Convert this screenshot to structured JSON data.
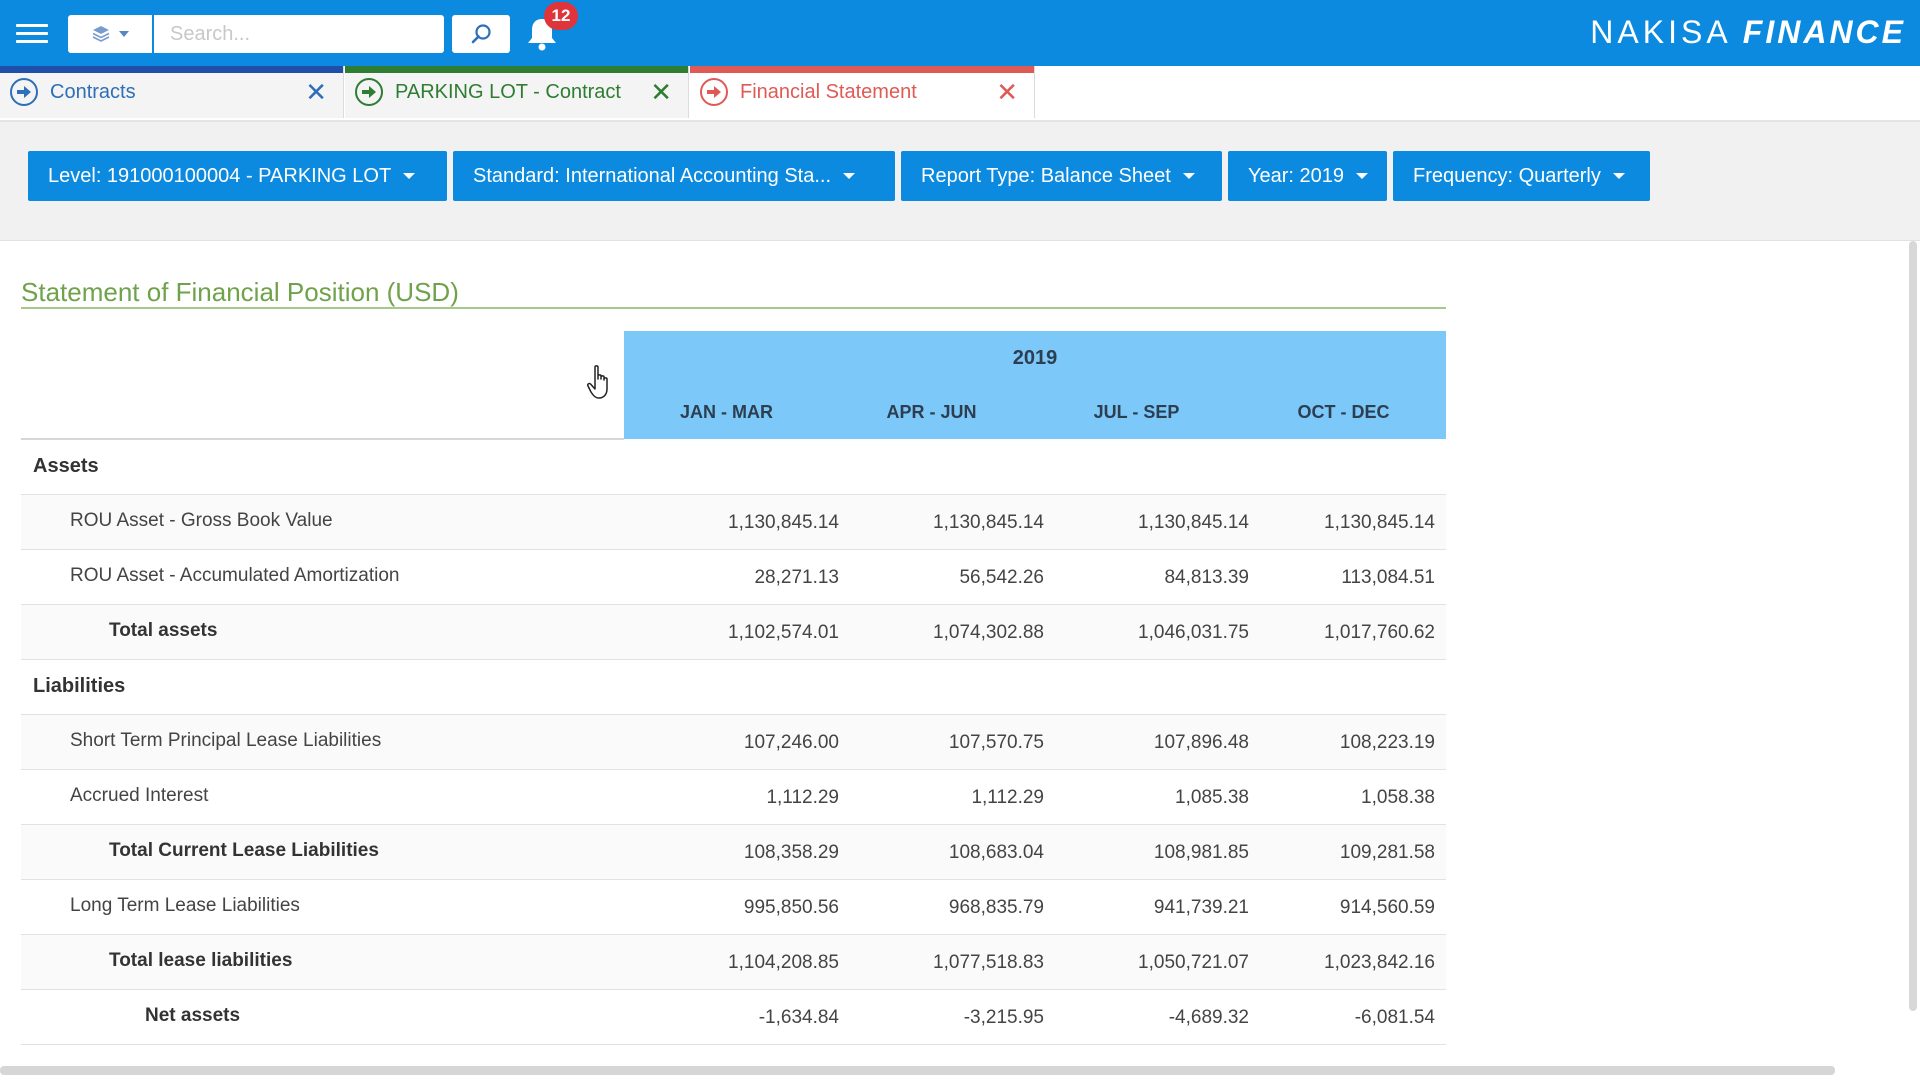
{
  "topbar": {
    "search_placeholder": "Search...",
    "notification_count": "12",
    "brand_part1": "NAKISA",
    "brand_part2": "FINANCE"
  },
  "tabs": [
    {
      "label": "Contracts",
      "close": "✕"
    },
    {
      "label": "PARKING LOT - Contract",
      "close": "✕"
    },
    {
      "label": "Financial Statement",
      "close": "✕"
    }
  ],
  "filters": {
    "level": "Level: 191000100004 - PARKING LOT",
    "standard": "Standard: International Accounting Sta...",
    "report_type": "Report Type: Balance Sheet",
    "year": "Year: 2019",
    "frequency": "Frequency: Quarterly"
  },
  "statement": {
    "title": "Statement of Financial Position (USD)",
    "year": "2019",
    "columns": [
      "JAN - MAR",
      "APR - JUN",
      "JUL - SEP",
      "OCT - DEC"
    ],
    "rows": [
      {
        "label": "Assets",
        "values": [
          "",
          "",
          "",
          ""
        ]
      },
      {
        "label": "ROU Asset - Gross Book Value",
        "values": [
          "1,130,845.14",
          "1,130,845.14",
          "1,130,845.14",
          "1,130,845.14"
        ]
      },
      {
        "label": "ROU Asset - Accumulated Amortization",
        "values": [
          "28,271.13",
          "56,542.26",
          "84,813.39",
          "113,084.51"
        ]
      },
      {
        "label": "Total assets",
        "values": [
          "1,102,574.01",
          "1,074,302.88",
          "1,046,031.75",
          "1,017,760.62"
        ]
      },
      {
        "label": "Liabilities",
        "values": [
          "",
          "",
          "",
          ""
        ]
      },
      {
        "label": "Short Term Principal Lease Liabilities",
        "values": [
          "107,246.00",
          "107,570.75",
          "107,896.48",
          "108,223.19"
        ]
      },
      {
        "label": "Accrued Interest",
        "values": [
          "1,112.29",
          "1,112.29",
          "1,085.38",
          "1,058.38"
        ]
      },
      {
        "label": "Total Current Lease Liabilities",
        "values": [
          "108,358.29",
          "108,683.04",
          "108,981.85",
          "109,281.58"
        ]
      },
      {
        "label": "Long Term Lease Liabilities",
        "values": [
          "995,850.56",
          "968,835.79",
          "941,739.21",
          "914,560.59"
        ]
      },
      {
        "label": "Total lease liabilities",
        "values": [
          "1,104,208.85",
          "1,077,518.83",
          "1,050,721.07",
          "1,023,842.16"
        ]
      },
      {
        "label": "Net assets",
        "values": [
          "-1,634.84",
          "-3,215.95",
          "-4,689.32",
          "-6,081.54"
        ]
      }
    ]
  },
  "colors": {
    "primary_blue": "#0b8ae0",
    "header_blue": "#7cc8f8",
    "title_green": "#6fa24a",
    "tab1_accent": "#1f4fa8",
    "tab2_accent": "#2e7d32",
    "tab3_accent": "#e05a55",
    "badge_red": "#e0343b"
  }
}
